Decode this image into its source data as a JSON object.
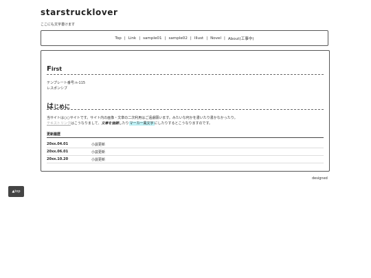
{
  "header": {
    "site_title": "starstrucklover",
    "tagline": "ここにも文字書けます"
  },
  "nav": {
    "items": [
      "Top",
      "Link",
      "sample01",
      "sample02",
      "Illust",
      "Novel",
      "About(工事中)"
    ],
    "separator": "|"
  },
  "main": {
    "section1": {
      "heading_first": "F",
      "heading_rest": "irst",
      "lines": [
        "テンプレート番号:n-115",
        "レスポンシブ"
      ]
    },
    "section2": {
      "heading_first": "は",
      "heading_rest": "じめに",
      "line1": "当サイトは○○サイトです。サイト内の画像・文章の二次利用はご遠慮願います。みたいな何かを書いたり書かなかったり。",
      "link_text": "テキストリンク",
      "text_a": "はこうなりまして、",
      "bold_text": "文章を強調",
      "text_b": "したり",
      "marker_text": "マーカー風文字",
      "text_c": "にしたりするとこうなりますのです。"
    },
    "history": {
      "heading": "更新履歴",
      "rows": [
        {
          "date": "20xx.04.01",
          "event": "小説更新"
        },
        {
          "date": "20xx.06.01",
          "event": "小説更新"
        },
        {
          "date": "20xx.10.20",
          "event": "小説更新"
        }
      ]
    }
  },
  "footer": {
    "designed": "designed",
    "top_button": "▲top"
  }
}
